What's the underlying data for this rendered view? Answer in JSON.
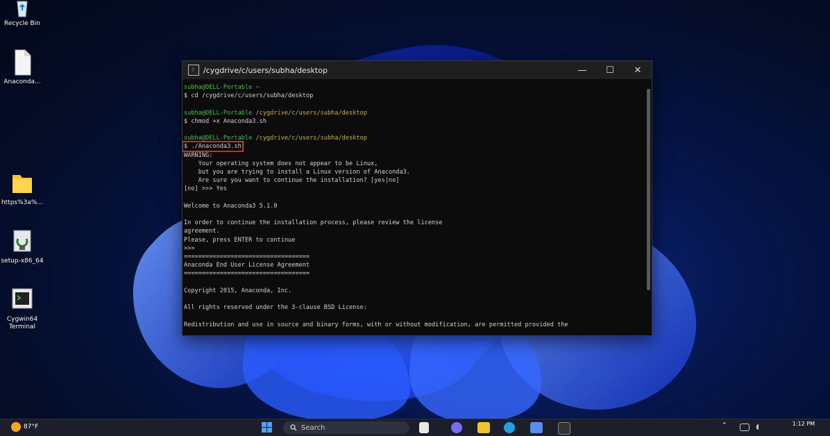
{
  "desktop": {
    "icons": [
      {
        "label": "Recycle Bin"
      },
      {
        "label": "Anaconda..."
      },
      {
        "label": "https%3a%..."
      },
      {
        "label": "setup-x86_64"
      },
      {
        "label": "Cygwin64\nTerminal"
      }
    ]
  },
  "window": {
    "title": "/cygdrive/c/users/subha/desktop",
    "controls": {
      "minimize": "—",
      "maximize": "☐",
      "close": "✕"
    },
    "lines": [
      {
        "kind": "prompt",
        "user": "subha@DELL-Portable",
        "path": " ~"
      },
      {
        "kind": "text",
        "text": "$ cd /cygdrive/c/users/subha/desktop"
      },
      {
        "kind": "blank",
        "text": ""
      },
      {
        "kind": "prompt",
        "user": "subha@DELL-Portable",
        "path": " /cygdrive/c/users/subha/desktop"
      },
      {
        "kind": "text",
        "text": "$ chmod +x Anaconda3.sh"
      },
      {
        "kind": "blank",
        "text": ""
      },
      {
        "kind": "prompt",
        "user": "subha@DELL-Portable",
        "path": " /cygdrive/c/users/subha/desktop"
      },
      {
        "kind": "highlight",
        "text": "$ ./Anaconda3.sh"
      },
      {
        "kind": "text",
        "text": "WARNING:"
      },
      {
        "kind": "text",
        "text": "    Your operating system does not appear to be Linux,"
      },
      {
        "kind": "text",
        "text": "    but you are trying to install a Linux version of Anaconda3."
      },
      {
        "kind": "text",
        "text": "    Are sure you want to continue the installation? [yes|no]"
      },
      {
        "kind": "text",
        "text": "[no] >>> Yes"
      },
      {
        "kind": "blank",
        "text": ""
      },
      {
        "kind": "text",
        "text": "Welcome to Anaconda3 5.1.0"
      },
      {
        "kind": "blank",
        "text": ""
      },
      {
        "kind": "text",
        "text": "In order to continue the installation process, please review the license"
      },
      {
        "kind": "text",
        "text": "agreement."
      },
      {
        "kind": "text",
        "text": "Please, press ENTER to continue"
      },
      {
        "kind": "text",
        "text": ">>>"
      },
      {
        "kind": "text",
        "text": "==================================="
      },
      {
        "kind": "text",
        "text": "Anaconda End User License Agreement"
      },
      {
        "kind": "text",
        "text": "==================================="
      },
      {
        "kind": "blank",
        "text": ""
      },
      {
        "kind": "text",
        "text": "Copyright 2015, Anaconda, Inc."
      },
      {
        "kind": "blank",
        "text": ""
      },
      {
        "kind": "text",
        "text": "All rights reserved under the 3-clause BSD License:"
      },
      {
        "kind": "blank",
        "text": ""
      },
      {
        "kind": "text",
        "text": "Redistribution and use in source and binary forms, with or without modification, are permitted provided the"
      }
    ]
  },
  "taskbar": {
    "weather": "87°F",
    "search_placeholder": "Search",
    "clock_time": "1:12 PM"
  },
  "colors": {
    "prompt_user": "#3fbf3f",
    "prompt_path": "#c8b23a",
    "highlight_box": "#e02424",
    "wallpaper_blue": "#1a4dff"
  }
}
